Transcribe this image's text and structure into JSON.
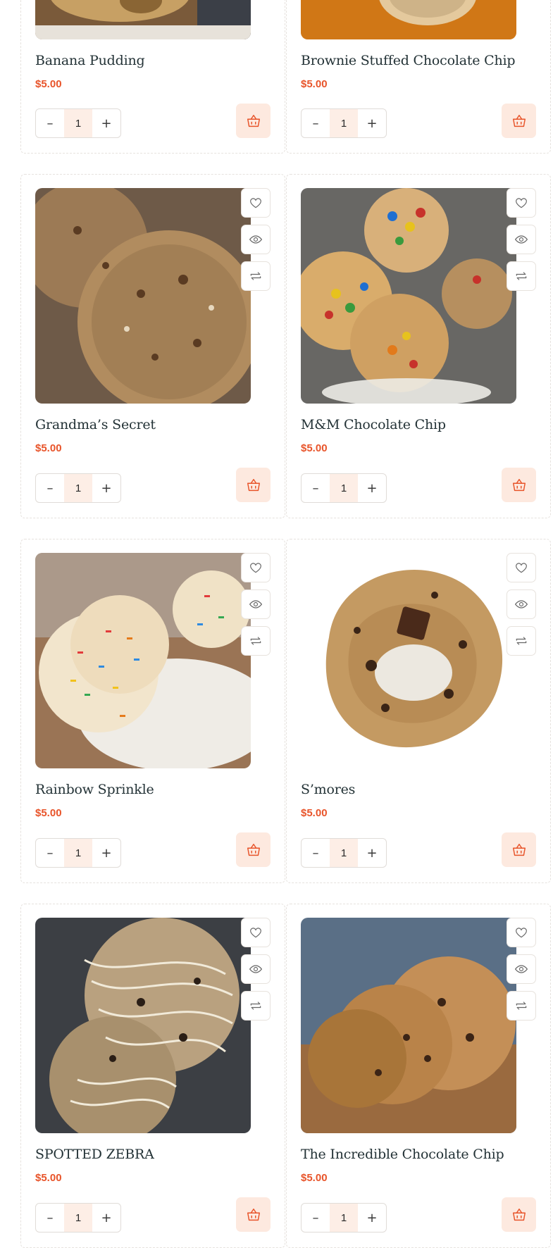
{
  "products": [
    {
      "name": "Banana Pudding",
      "price": "$5.00",
      "qty": "1",
      "image_icons": false
    },
    {
      "name": "Brownie Stuffed Chocolate Chip",
      "price": "$5.00",
      "qty": "1",
      "image_icons": false
    },
    {
      "name": "Grandma’s Secret",
      "price": "$5.00",
      "qty": "1",
      "image_icons": true
    },
    {
      "name": "M&M Chocolate Chip",
      "price": "$5.00",
      "qty": "1",
      "image_icons": true
    },
    {
      "name": "Rainbow Sprinkle",
      "price": "$5.00",
      "qty": "1",
      "image_icons": true
    },
    {
      "name": "S’mores",
      "price": "$5.00",
      "qty": "1",
      "image_icons": true
    },
    {
      "name": "SPOTTED ZEBRA",
      "price": "$5.00",
      "qty": "1",
      "image_icons": true
    },
    {
      "name": "The Incredible Chocolate Chip",
      "price": "$5.00",
      "qty": "1",
      "image_icons": true
    }
  ],
  "controls": {
    "minus": "–",
    "plus": "+"
  },
  "icons": {
    "wishlist": "heart-icon",
    "quick_view": "eye-icon",
    "compare": "compare-arrows-icon",
    "add_to_cart": "basket-icon"
  },
  "colors": {
    "price": "#e8542a",
    "cart_bg": "#fde9df",
    "qty_bg": "#fdeee6",
    "title": "#233236"
  }
}
